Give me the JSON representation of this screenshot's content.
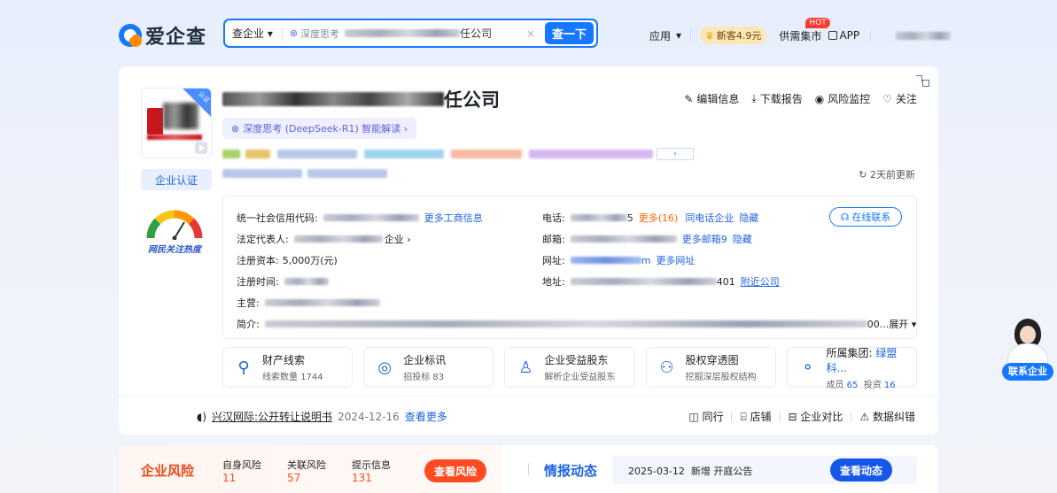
{
  "header": {
    "logo_text": "爱企查",
    "search": {
      "scope": "查企业",
      "deepseek_label": "深度思考",
      "query_suffix": "任公司",
      "clear_glyph": "×",
      "button": "查一下"
    },
    "nav": {
      "app": "应用",
      "vip": "新客4.9元",
      "market": "供需集市",
      "hot": "HOT",
      "app_download": "APP"
    }
  },
  "company": {
    "name_suffix": "任公司",
    "ribbon": "认证",
    "actions": {
      "edit": "编辑信息",
      "download": "下载报告",
      "monitor": "风险监控",
      "follow": "关注"
    },
    "ai_chip": "深度思考 (DeepSeek-R1) 智能解读 ›",
    "cert": "企业认证",
    "heat_label": "网民关注热度",
    "updated": "2天前更新"
  },
  "info": {
    "credit_code_label": "统一社会信用代码:",
    "more_business": "更多工商信息",
    "legal_rep_label": "法定代表人:",
    "legal_rep_suffix": "企业 ›",
    "capital_label": "注册资本:",
    "capital_value": "5,000万(元)",
    "reg_time_label": "注册时间:",
    "main_label": "主营:",
    "intro_label": "简介:",
    "intro_tail": "00...",
    "expand": "展开",
    "phone_label": "电话:",
    "phone_tail": "5",
    "more_phones": "更多(16)",
    "same_phone": "同电话企业",
    "hide": "隐藏",
    "email_label": "邮箱:",
    "more_email": "更多邮箱9",
    "website_label": "网址:",
    "website_tail": "m",
    "more_website": "更多网址",
    "address_label": "地址:",
    "address_tail": "401",
    "nearby": "附近公司",
    "contact_online": "在线联系"
  },
  "features": [
    {
      "title": "财产线索",
      "sub_prefix": "线索数量",
      "sub_value": "1744",
      "icon": "clue-icon"
    },
    {
      "title": "企业标讯",
      "sub_prefix": "招投标",
      "sub_value": "83",
      "icon": "bid-icon"
    },
    {
      "title": "企业受益股东",
      "sub_prefix": "解析企业受益股东",
      "sub_value": "",
      "icon": "beneficiary-icon"
    },
    {
      "title": "股权穿透图",
      "sub_prefix": "挖掘深层股权结构",
      "sub_value": "",
      "icon": "equity-icon"
    },
    {
      "title": "所属集团:",
      "title_link": "绿盟科...",
      "sub_prefix": "成员",
      "sub_value": "65",
      "sub2_prefix": "投资",
      "sub2_value": "16",
      "icon": "group-icon"
    }
  ],
  "announcement": {
    "title": "兴汉网际:公开转让说明书",
    "date": "2024-12-16",
    "more": "查看更多"
  },
  "foot_tools": [
    "同行",
    "店铺",
    "企业对比",
    "数据纠错"
  ],
  "float_contact": "联系企业",
  "risk": {
    "title": "企业风险",
    "items": [
      {
        "label": "自身风险",
        "value": "11"
      },
      {
        "label": "关联风险",
        "value": "57"
      },
      {
        "label": "提示信息",
        "value": "131"
      }
    ],
    "button": "查看风险"
  },
  "intel": {
    "title": "情报动态",
    "date": "2025-03-12",
    "text": "新增 开庭公告",
    "button": "查看动态"
  },
  "colors": {
    "brand": "#1677ff",
    "risk": "#ff4a22",
    "link": "#1f63e0"
  }
}
